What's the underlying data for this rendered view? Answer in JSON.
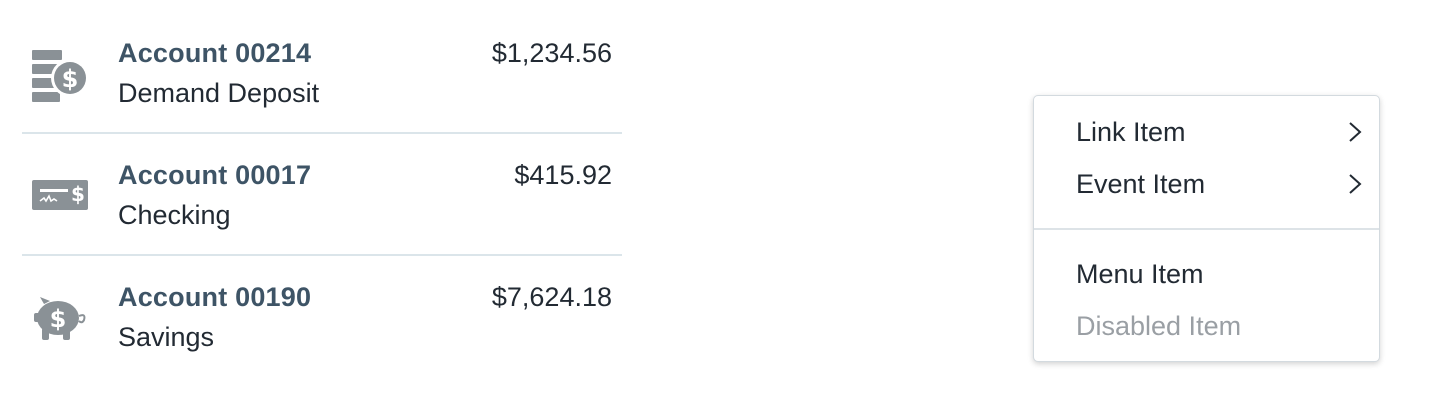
{
  "accounts": [
    {
      "name": "Account 00214",
      "type": "Demand Deposit",
      "balance": "$1,234.56",
      "icon": "money-stack-icon"
    },
    {
      "name": "Account 00017",
      "type": "Checking",
      "balance": "$415.92",
      "icon": "check-icon"
    },
    {
      "name": "Account 00190",
      "type": "Savings",
      "balance": "$7,624.18",
      "icon": "piggy-bank-icon"
    }
  ],
  "menu": {
    "items": [
      {
        "label": "Link Item",
        "has_submenu": true,
        "icon": "chevron-right-icon"
      },
      {
        "label": "Event Item",
        "has_submenu": true,
        "icon": "chevron-right-icon"
      },
      {
        "label": "Menu Item",
        "has_submenu": false
      },
      {
        "label": "Disabled Item",
        "has_submenu": false,
        "disabled": true
      }
    ]
  },
  "colors": {
    "account_name": "#3e5466",
    "text": "#222a33",
    "icon": "#8a9196",
    "divider": "#dbe5ea",
    "disabled_text": "#9a9fa4"
  }
}
